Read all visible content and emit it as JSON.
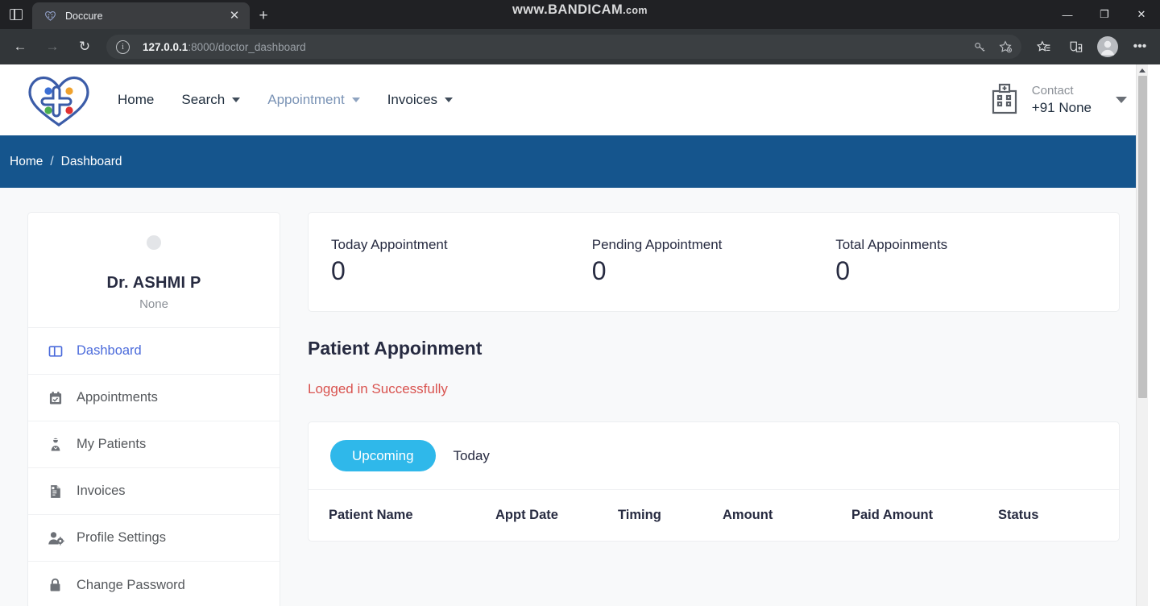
{
  "browser": {
    "watermark_main": "www.BANDICAM",
    "watermark_suffix": ".com",
    "tab_title": "Doccure",
    "new_tab_glyph": "+",
    "close_glyph": "✕",
    "back_glyph": "←",
    "forward_glyph": "→",
    "reload_glyph": "↻",
    "info_glyph": "i",
    "url_host": "127.0.0.1",
    "url_path": ":8000/doctor_dashboard",
    "minimize_glyph": "—",
    "maximize_glyph": "❐",
    "close_window_glyph": "✕",
    "more_glyph": "•••"
  },
  "header": {
    "nav": [
      {
        "label": "Home",
        "has_caret": false,
        "active": false
      },
      {
        "label": "Search",
        "has_caret": true,
        "active": false
      },
      {
        "label": "Appointment",
        "has_caret": true,
        "active": true
      },
      {
        "label": "Invoices",
        "has_caret": true,
        "active": false
      }
    ],
    "contact_label": "Contact",
    "contact_number": "+91 None"
  },
  "breadcrumb": {
    "home": "Home",
    "separator": "/",
    "current": "Dashboard"
  },
  "sidebar": {
    "doctor_name": "Dr. ASHMI P",
    "doctor_subtitle": "None",
    "items": [
      {
        "label": "Dashboard",
        "icon": "dashboard-icon",
        "active": true
      },
      {
        "label": "Appointments",
        "icon": "calendar-check-icon",
        "active": false
      },
      {
        "label": "My Patients",
        "icon": "patients-icon",
        "active": false
      },
      {
        "label": "Invoices",
        "icon": "invoice-document-icon",
        "active": false
      },
      {
        "label": "Profile Settings",
        "icon": "user-gear-icon",
        "active": false
      },
      {
        "label": "Change Password",
        "icon": "lock-icon",
        "active": false
      }
    ]
  },
  "stats": [
    {
      "label": "Today Appointment",
      "value": "0"
    },
    {
      "label": "Pending Appointment",
      "value": "0"
    },
    {
      "label": "Total Appoinments",
      "value": "0"
    }
  ],
  "main": {
    "section_title": "Patient Appoinment",
    "flash_message": "Logged in Successfully",
    "tabs": [
      {
        "label": "Upcoming",
        "active": true
      },
      {
        "label": "Today",
        "active": false
      }
    ],
    "table_headers": [
      "Patient Name",
      "Appt Date",
      "Timing",
      "Amount",
      "Paid Amount",
      "Status"
    ],
    "table_rows": []
  },
  "colors": {
    "breadcrumb_bg": "#15558d",
    "active_pill": "#2fb8ea",
    "flash_red": "#d9534f",
    "sidebar_active": "#4b6bdb",
    "nav_active": "#7a93b5"
  }
}
